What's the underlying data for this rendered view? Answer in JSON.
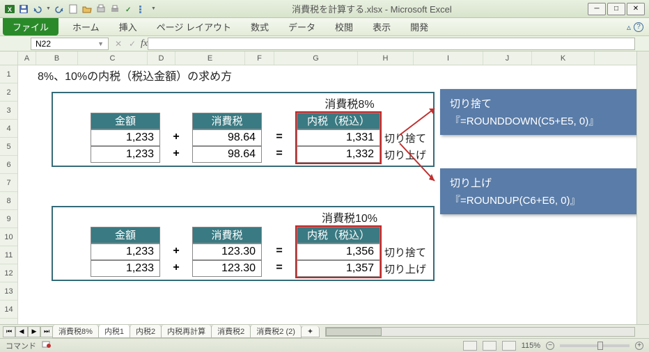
{
  "titlebar": {
    "title": "消費税を計算する.xlsx - Microsoft Excel"
  },
  "ribbon": {
    "file": "ファイル",
    "tabs": [
      "ホーム",
      "挿入",
      "ページ レイアウト",
      "数式",
      "データ",
      "校閲",
      "表示",
      "開発"
    ]
  },
  "namebox": "N22",
  "fx_label": "fx",
  "formula": "",
  "columns": [
    "A",
    "B",
    "C",
    "D",
    "E",
    "F",
    "G",
    "H",
    "I",
    "J",
    "K"
  ],
  "rows": [
    "1",
    "2",
    "3",
    "4",
    "5",
    "6",
    "7",
    "8",
    "9",
    "10",
    "11",
    "12",
    "13",
    "14"
  ],
  "sheet": {
    "title": "8%、10%の内税（税込金額）の求め方",
    "tax8_label": "消費税8%",
    "tax10_label": "消費税10%",
    "headers": {
      "amount": "金額",
      "tax": "消費税",
      "incl": "内税（税込）"
    },
    "ops": {
      "plus": "+",
      "eq": "="
    },
    "labels": {
      "down": "切り捨て",
      "up": "切り上げ"
    },
    "block1": {
      "r1": {
        "amount": "1,233",
        "tax": "98.64",
        "incl": "1,331"
      },
      "r2": {
        "amount": "1,233",
        "tax": "98.64",
        "incl": "1,332"
      }
    },
    "block2": {
      "r1": {
        "amount": "1,233",
        "tax": "123.30",
        "incl": "1,356"
      },
      "r2": {
        "amount": "1,233",
        "tax": "123.30",
        "incl": "1,357"
      }
    }
  },
  "callouts": {
    "c1": {
      "title": "切り捨て",
      "formula": "『=ROUNDDOWN(C5+E5, 0)』"
    },
    "c2": {
      "title": "切り上げ",
      "formula": "『=ROUNDUP(C6+E6, 0)』"
    }
  },
  "sheettabs": [
    "消費税8%",
    "内税1",
    "内税2",
    "内税再計算",
    "消費税2",
    "消費税2 (2)"
  ],
  "active_tab": 1,
  "status": {
    "mode": "コマンド",
    "zoom": "115%"
  }
}
